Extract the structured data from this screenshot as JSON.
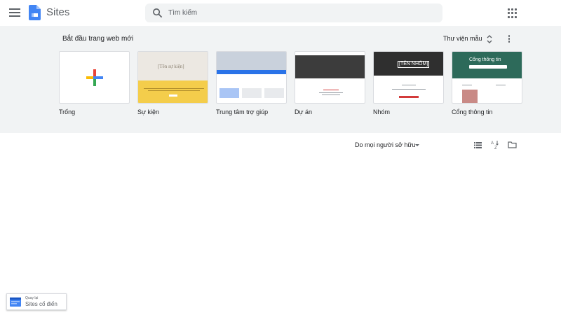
{
  "app": {
    "name": "Sites"
  },
  "icons": {
    "menu": "hamburger-menu-icon",
    "logo": "google-sites-logo",
    "search": "search-icon",
    "apps": "apps-grid-icon",
    "unfold": "unfold-more-icon",
    "more": "more-vert-icon",
    "caret": "caret-down-icon",
    "list": "list-view-icon",
    "sort": "sort-az-icon",
    "folder": "folder-icon"
  },
  "search": {
    "placeholder": "Tìm kiếm"
  },
  "gallery": {
    "title": "Bắt đầu trang web mới",
    "library_label": "Thư viện mẫu",
    "templates": [
      {
        "label": "Trống"
      },
      {
        "label": "Sự kiện",
        "thumb_title": "[Tên sự kiện]"
      },
      {
        "label": "Trung tâm trợ giúp"
      },
      {
        "label": "Dự án"
      },
      {
        "label": "Nhóm",
        "thumb_title": "[TÊN NHÓM]"
      },
      {
        "label": "Cổng thông tin",
        "thumb_title": "Cổng thông tin"
      }
    ]
  },
  "filter": {
    "owner_label": "Do mọi người sở hữu"
  },
  "classic": {
    "small_label": "Quay lại",
    "main_label": "Sites cổ điển"
  },
  "colors": {
    "gallery_bg": "#f1f3f4",
    "sites_blue": "#4285f4",
    "google_red": "#ea4335",
    "google_yellow": "#fbbc04",
    "google_green": "#34a853",
    "event_yellow": "#f4cd4b",
    "help_blue": "#2a73e8",
    "group_red": "#d33b3b",
    "portal_green": "#2d6a5a"
  }
}
